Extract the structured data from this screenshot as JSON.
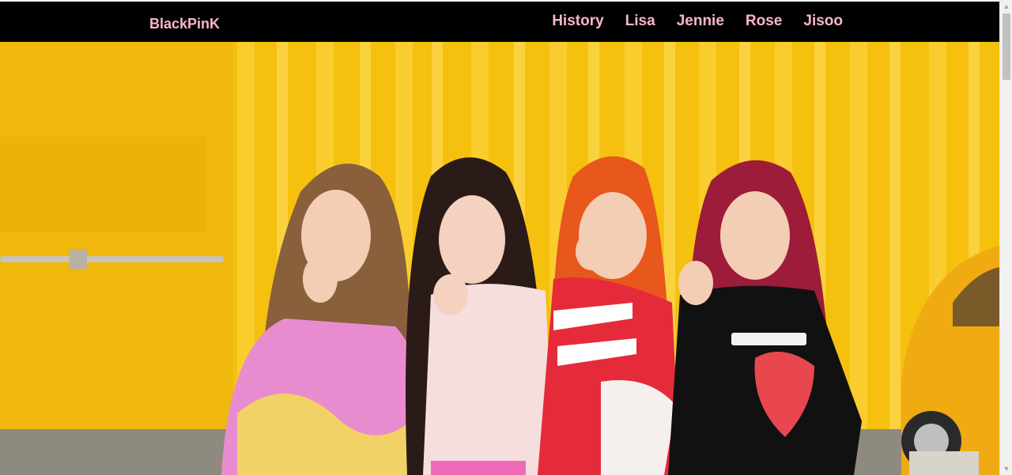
{
  "navbar": {
    "brand": "BlackPinK",
    "links": [
      {
        "label": "History"
      },
      {
        "label": "Lisa"
      },
      {
        "label": "Jennie"
      },
      {
        "label": "Rose"
      },
      {
        "label": "Jisoo"
      }
    ]
  },
  "colors": {
    "navbar_bg": "#000000",
    "nav_text": "#f7b6c9",
    "hero_wall": "#f5c10e"
  },
  "hero": {
    "icon": "group-photo"
  },
  "scrollbar": {
    "up_icon": "chevron-up-icon",
    "down_icon": "chevron-down-icon"
  }
}
